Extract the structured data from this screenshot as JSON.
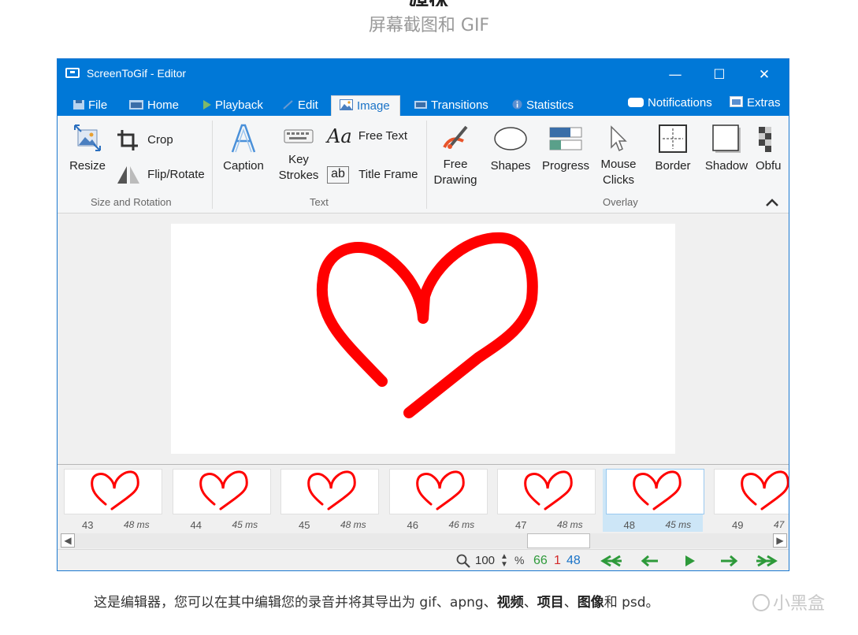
{
  "page": {
    "heading": "媒体",
    "subtitle": "屏幕截图和 GIF",
    "caption_parts": [
      "这是编辑器，您可以在其中编辑您的录音并将其导出为 gif、apng、",
      "视频",
      "、",
      "项目",
      "、",
      "图像",
      "和 psd。"
    ],
    "watermark": "小黑盒"
  },
  "window": {
    "title": "ScreenToGif - Editor",
    "controls": {
      "minimize": "—",
      "maximize": "☐",
      "close": "✕"
    }
  },
  "tabs": [
    {
      "label": "File",
      "icon": "floppy-icon"
    },
    {
      "label": "Home",
      "icon": "home-icon"
    },
    {
      "label": "Playback",
      "icon": "play-icon"
    },
    {
      "label": "Edit",
      "icon": "pencil-icon"
    },
    {
      "label": "Image",
      "icon": "image-icon",
      "active": true
    },
    {
      "label": "Transitions",
      "icon": "transitions-icon"
    },
    {
      "label": "Statistics",
      "icon": "info-icon"
    }
  ],
  "tab_right": {
    "notifications": "Notifications",
    "extras": "Extras"
  },
  "ribbon": {
    "resize": "Resize",
    "crop": "Crop",
    "flip_rotate": "Flip/Rotate",
    "group_size": "Size and Rotation",
    "caption": "Caption",
    "key_strokes_1": "Key",
    "key_strokes_2": "Strokes",
    "free_text": "Free Text",
    "title_frame": "Title Frame",
    "group_text": "Text",
    "free_drawing_1": "Free",
    "free_drawing_2": "Drawing",
    "shapes": "Shapes",
    "progress": "Progress",
    "mouse_clicks_1": "Mouse",
    "mouse_clicks_2": "Clicks",
    "border": "Border",
    "shadow": "Shadow",
    "obfuscate": "Obfu",
    "group_overlay": "Overlay",
    "text_icon_aa": "Aa",
    "text_icon_ab": "ab"
  },
  "frames": [
    {
      "num": "43",
      "ms": "48 ms"
    },
    {
      "num": "44",
      "ms": "45 ms"
    },
    {
      "num": "45",
      "ms": "48 ms"
    },
    {
      "num": "46",
      "ms": "46 ms"
    },
    {
      "num": "47",
      "ms": "48 ms"
    },
    {
      "num": "48",
      "ms": "45 ms",
      "selected": true
    },
    {
      "num": "49",
      "ms": "47"
    }
  ],
  "status": {
    "zoom": "100",
    "percent": "%",
    "total_frames": "66",
    "selected_count": "1",
    "current_frame": "48",
    "colors": {
      "total": "#2e9a3a",
      "selected": "#d42a2a",
      "current": "#1a73c7",
      "nav": "#2e9a3a"
    }
  },
  "colors": {
    "accent": "#0078d7",
    "heart": "#ff0000"
  }
}
